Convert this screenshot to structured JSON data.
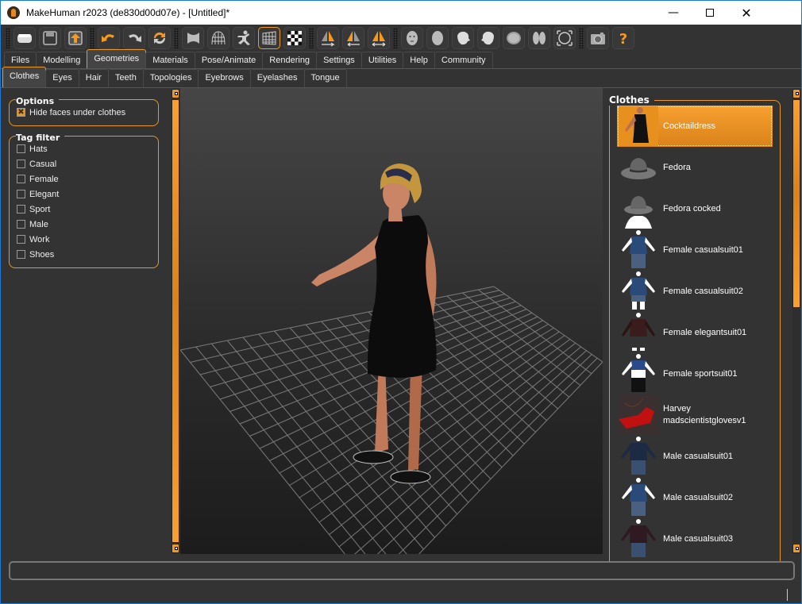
{
  "window": {
    "title": "MakeHuman r2023 (de830d00d07e) - [Untitled]*",
    "controls": [
      "minimize",
      "maximize",
      "close"
    ]
  },
  "toolbar": {
    "groups": [
      [
        {
          "icon": "load-icon",
          "label": "Load"
        },
        {
          "icon": "save-icon",
          "label": "Save"
        },
        {
          "icon": "export-icon",
          "label": "Export"
        }
      ],
      [
        {
          "icon": "undo-icon",
          "label": "Undo"
        },
        {
          "icon": "redo-icon",
          "label": "Redo"
        },
        {
          "icon": "reset-icon",
          "label": "Reset"
        }
      ],
      [
        {
          "icon": "smooth-icon",
          "label": "Smooth"
        },
        {
          "icon": "wireframe-icon",
          "label": "Wireframe"
        },
        {
          "icon": "pose-icon",
          "label": "Pose"
        },
        {
          "icon": "grid-icon",
          "label": "Grid",
          "active": true
        },
        {
          "icon": "background-icon",
          "label": "Background"
        }
      ],
      [
        {
          "icon": "symmetry-right-icon",
          "label": "Symmetry R>L"
        },
        {
          "icon": "symmetry-left-icon",
          "label": "Symmetry L>R"
        },
        {
          "icon": "symmetry-icon",
          "label": "Symmetry"
        }
      ],
      [
        {
          "icon": "front-view-icon",
          "label": "Front view"
        },
        {
          "icon": "back-view-icon",
          "label": "Back view"
        },
        {
          "icon": "left-view-icon",
          "label": "Left view"
        },
        {
          "icon": "right-view-icon",
          "label": "Right view"
        },
        {
          "icon": "top-view-icon",
          "label": "Top view"
        },
        {
          "icon": "bottom-view-icon",
          "label": "Bottom view"
        },
        {
          "icon": "reset-camera-icon",
          "label": "Reset camera"
        }
      ],
      [
        {
          "icon": "screenshot-icon",
          "label": "Screenshot"
        },
        {
          "icon": "help-icon",
          "label": "Help"
        }
      ]
    ]
  },
  "main_tabs": [
    {
      "label": "Files"
    },
    {
      "label": "Modelling"
    },
    {
      "label": "Geometries",
      "active": true
    },
    {
      "label": "Materials"
    },
    {
      "label": "Pose/Animate"
    },
    {
      "label": "Rendering"
    },
    {
      "label": "Settings"
    },
    {
      "label": "Utilities"
    },
    {
      "label": "Help"
    },
    {
      "label": "Community"
    }
  ],
  "sub_tabs": [
    {
      "label": "Clothes",
      "active": true
    },
    {
      "label": "Eyes"
    },
    {
      "label": "Hair"
    },
    {
      "label": "Teeth"
    },
    {
      "label": "Topologies"
    },
    {
      "label": "Eyebrows"
    },
    {
      "label": "Eyelashes"
    },
    {
      "label": "Tongue"
    }
  ],
  "left_panel": {
    "options": {
      "title": "Options",
      "items": [
        {
          "label": "Hide faces under clothes",
          "checked": true
        }
      ]
    },
    "tag_filter": {
      "title": "Tag filter",
      "items": [
        {
          "label": "Hats",
          "checked": false
        },
        {
          "label": "Casual",
          "checked": false
        },
        {
          "label": "Female",
          "checked": false
        },
        {
          "label": "Elegant",
          "checked": false
        },
        {
          "label": "Sport",
          "checked": false
        },
        {
          "label": "Male",
          "checked": false
        },
        {
          "label": "Work",
          "checked": false
        },
        {
          "label": "Shoes",
          "checked": false
        }
      ]
    }
  },
  "right_panel": {
    "title": "Clothes",
    "items": [
      {
        "label": "Cocktaildress",
        "selected": true,
        "thumb": "dress"
      },
      {
        "label": "Fedora",
        "thumb": "hat"
      },
      {
        "label": "Fedora cocked",
        "thumb": "hat-head"
      },
      {
        "label": "Female casualsuit01",
        "thumb": "suit-blue"
      },
      {
        "label": "Female casualsuit02",
        "thumb": "suit-blue-shorts"
      },
      {
        "label": "Female elegantsuit01",
        "thumb": "suit-dark"
      },
      {
        "label": "Female sportsuit01",
        "thumb": "suit-sport"
      },
      {
        "label": "Harvey madscientistglovesv1",
        "thumb": "gloves"
      },
      {
        "label": "Male casualsuit01",
        "thumb": "suit-navy"
      },
      {
        "label": "Male casualsuit02",
        "thumb": "suit-blue"
      },
      {
        "label": "Male casualsuit03",
        "thumb": "suit-maroon"
      }
    ]
  },
  "left_scroll": {
    "position": 0.0,
    "visible_fraction": 1.0
  },
  "right_scroll": {
    "position": 0.0,
    "visible_fraction": 0.5
  },
  "statusbar": {
    "text": ""
  },
  "colors": {
    "accent": "#f09a20",
    "background": "#333333",
    "selected": "#e8901e"
  }
}
